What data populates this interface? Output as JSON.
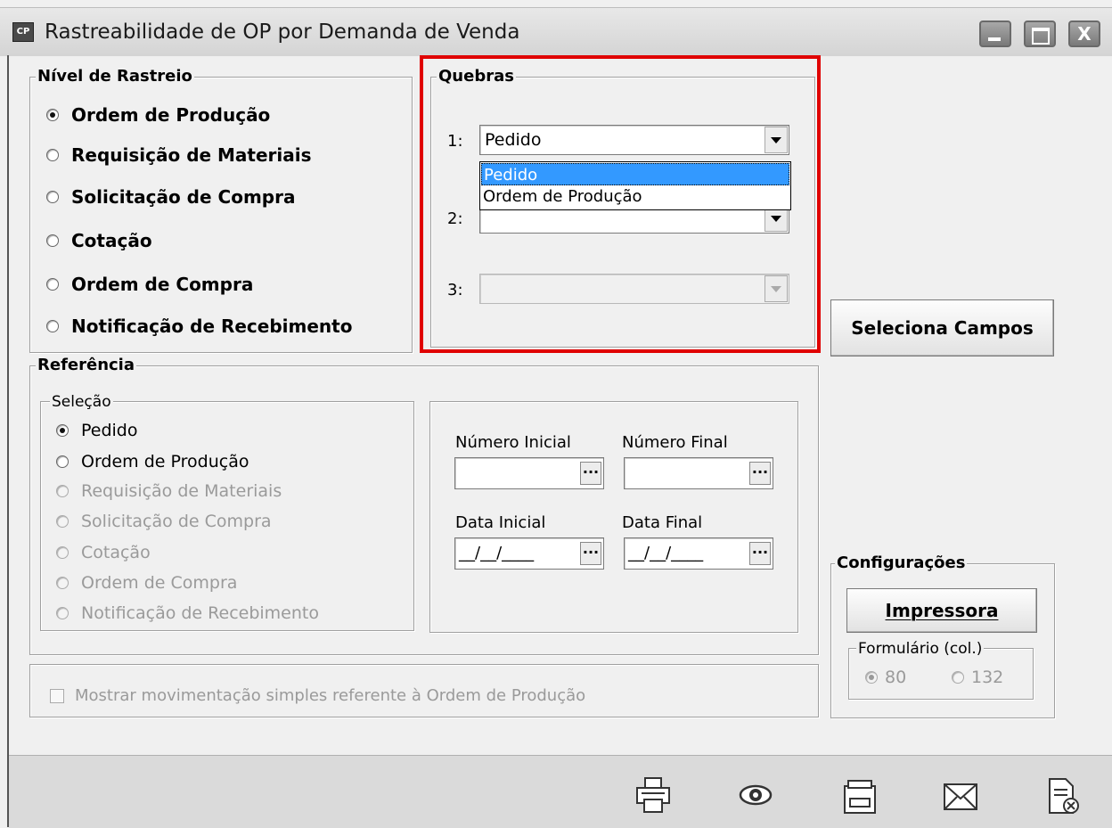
{
  "window": {
    "icon_text": "CP",
    "title": "Rastreabilidade de OP por Demanda de Venda",
    "controls": {
      "minimize": "_",
      "maximize": "□",
      "close": "X"
    }
  },
  "nivel_rastreio": {
    "legend": "Nível de Rastreio",
    "options": [
      {
        "label": "Ordem de Produção",
        "selected": true
      },
      {
        "label": "Requisição de Materiais",
        "selected": false
      },
      {
        "label": "Solicitação de Compra",
        "selected": false
      },
      {
        "label": "Cotação",
        "selected": false
      },
      {
        "label": "Ordem de Compra",
        "selected": false
      },
      {
        "label": "Notificação de Recebimento",
        "selected": false
      }
    ]
  },
  "quebras": {
    "legend": "Quebras",
    "rows": [
      {
        "label": "1:",
        "value": "Pedido",
        "enabled": true
      },
      {
        "label": "2:",
        "value": "",
        "enabled": true
      },
      {
        "label": "3:",
        "value": "",
        "enabled": false
      }
    ],
    "dropdown_options": [
      "Pedido",
      "Ordem de Produção"
    ],
    "dropdown_selected": "Pedido"
  },
  "seleciona_campos_label": "Seleciona Campos",
  "referencia": {
    "legend": "Referência",
    "selecao": {
      "legend": "Seleção",
      "options": [
        {
          "label": "Pedido",
          "selected": true,
          "enabled": true
        },
        {
          "label": "Ordem de Produção",
          "selected": false,
          "enabled": true
        },
        {
          "label": "Requisição de Materiais",
          "selected": false,
          "enabled": false
        },
        {
          "label": "Solicitação de Compra",
          "selected": false,
          "enabled": false
        },
        {
          "label": "Cotação",
          "selected": false,
          "enabled": false
        },
        {
          "label": "Ordem de Compra",
          "selected": false,
          "enabled": false
        },
        {
          "label": "Notificação de Recebimento",
          "selected": false,
          "enabled": false
        }
      ]
    },
    "numero_inicial_label": "Número Inicial",
    "numero_final_label": "Número Final",
    "data_inicial_label": "Data Inicial",
    "data_final_label": "Data Final",
    "numero_inicial_value": "",
    "numero_final_value": "",
    "data_inicial_value": "__/__/____",
    "data_final_value": "__/__/____",
    "lookup_button": "..."
  },
  "mostrar_movimentacao_label": "Mostrar movimentação simples referente à Ordem de Produção",
  "configuracoes": {
    "legend": "Configurações",
    "impressora_label": "Impressora",
    "formulario": {
      "legend": "Formulário (col.)",
      "options": [
        {
          "label": "80",
          "selected": true
        },
        {
          "label": "132",
          "selected": false
        }
      ]
    }
  },
  "footer_icons": [
    "printer-icon",
    "preview-eye-icon",
    "export-file-icon",
    "email-icon",
    "close-report-icon"
  ],
  "colors": {
    "highlight_box": "#e00000",
    "selection_blue": "#3399ff"
  }
}
